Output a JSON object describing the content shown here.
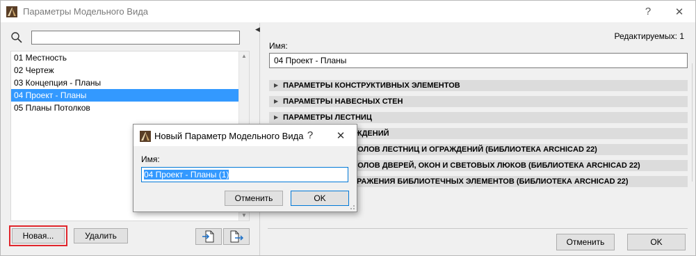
{
  "window": {
    "title": "Параметры Модельного Вида",
    "help_label": "?",
    "close_label": "✕"
  },
  "left": {
    "search_value": "",
    "items": [
      {
        "label": "01 Местность"
      },
      {
        "label": "02 Чертеж"
      },
      {
        "label": "03 Концепция - Планы"
      },
      {
        "label": "04 Проект - Планы"
      },
      {
        "label": "05 Планы Потолков"
      }
    ],
    "selected_index": 3,
    "new_button": "Новая...",
    "delete_button": "Удалить"
  },
  "right": {
    "edit_count": "Редактируемых: 1",
    "name_label": "Имя:",
    "name_value": "04 Проект - Планы",
    "sections": [
      "ПАРАМЕТРЫ КОНСТРУКТИВНЫХ ЭЛЕМЕНТОВ",
      "ПАРАМЕТРЫ НАВЕСНЫХ СТЕН",
      "ПАРАМЕТРЫ ЛЕСТНИЦ",
      "ПАРАМЕТРЫ ОГРАЖДЕНИЙ",
      "ПАРАМЕТРЫ СИМВОЛОВ ЛЕСТНИЦ И ОГРАЖДЕНИЙ (БИБЛИОТЕКА ARCHICAD 22)",
      "ПАРАМЕТРЫ СИМВОЛОВ ДВЕРЕЙ, ОКОН И СВЕТОВЫХ ЛЮКОВ (БИБЛИОТЕКА ARCHICAD 22)",
      "ПАРАМЕТРЫ ОТОБРАЖЕНИЯ БИБЛИОТЕЧНЫХ ЭЛЕМЕНТОВ (БИБЛИОТЕКА ARCHICAD 22)"
    ],
    "cancel_button": "Отменить",
    "ok_button": "OK"
  },
  "dialog": {
    "title": "Новый Параметр Модельного Вида",
    "help_label": "?",
    "close_label": "✕",
    "name_label": "Имя:",
    "name_value": "04 Проект - Планы (1)",
    "cancel_button": "Отменить",
    "ok_button": "OK"
  },
  "colors": {
    "selection": "#3399ff",
    "highlight_frame": "#e0262c",
    "focus_border": "#0078d7"
  }
}
